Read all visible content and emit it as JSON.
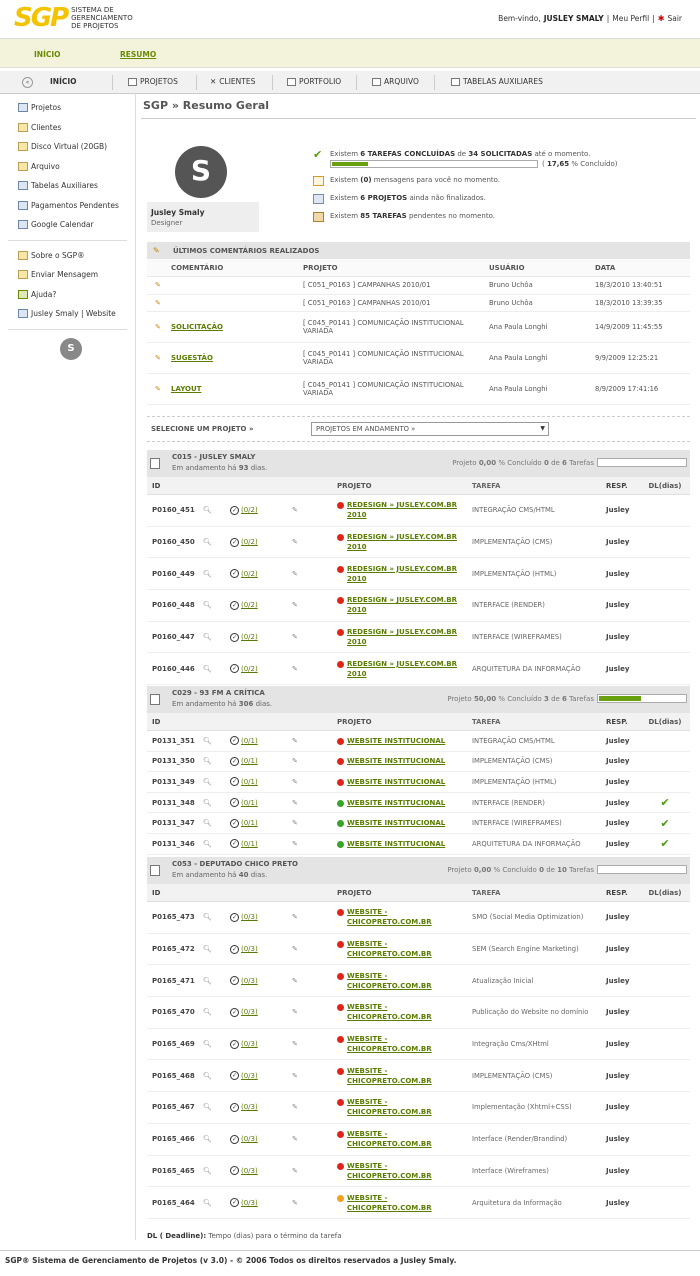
{
  "app": {
    "logo": "SGP",
    "logo_text": "SISTEMA DE GERENCIAMENTO DE PROJETOS",
    "welcome": "Bem-vindo,",
    "user": "JUSLEY SMALY",
    "profile": "Meu Perfil",
    "logout": "Sair"
  },
  "subnav": {
    "inicio": "INÍCIO",
    "resumo": "RESUMO"
  },
  "nav": {
    "back": "«",
    "inicio": "INÍCIO",
    "projetos": "PROJETOS",
    "clientes": "CLIENTES",
    "portfolio": "PORTFOLIO",
    "arquivo": "ARQUIVO",
    "tabelas": "TABELAS AUXILIARES"
  },
  "sidebar": {
    "items": [
      "Projetos",
      "Clientes",
      "Disco Virtual (20GB)",
      "Arquivo",
      "Tabelas Auxiliares",
      "Pagamentos Pendentes",
      "Google Calendar"
    ],
    "items2": [
      "Sobre o SGP®",
      "Enviar Mensagem",
      "Ajuda?",
      "Jusley Smaly | Website"
    ]
  },
  "page": {
    "title": "SGP » Resumo Geral"
  },
  "profile": {
    "name": "Jusley Smaly",
    "role": "Designer",
    "avatar": "S"
  },
  "stats": {
    "s1_pre": "Existem",
    "s1_a": "6 TAREFAS CONCLUÍDAS",
    "s1_mid": "de",
    "s1_b": "34 SOLICITADAS",
    "s1_post": "até o momento.",
    "progress_pre": "(",
    "progress_value": "17,65",
    "progress_post": "% Concluído)",
    "progress_fraction": 0.1765,
    "s2_pre": "Existem",
    "s2_b": "(0)",
    "s2_post": "mensagens para você no momento.",
    "s3_pre": "Existem",
    "s3_b": "6 PROJETOS",
    "s3_post": "ainda não finalizados.",
    "s4_pre": "Existem",
    "s4_b": "85 TAREFAS",
    "s4_post": "pendentes no momento."
  },
  "comments": {
    "heading": "ÚLTIMOS COMENTÁRIOS REALIZADOS",
    "headers": [
      "COMENTÁRIO",
      "PROJETO",
      "USUÁRIO",
      "DATA"
    ],
    "rows": [
      {
        "comment": "",
        "code": "[ C051_P0163 ]",
        "project": "CAMPANHAS 2010/01",
        "user": "Bruno Uchôa",
        "date": "18/3/2010 13:40:51"
      },
      {
        "comment": "",
        "code": "[ C051_P0163 ]",
        "project": "CAMPANHAS 2010/01",
        "user": "Bruno Uchôa",
        "date": "18/3/2010 13:39:35"
      },
      {
        "comment": "SOLICITAÇÃO",
        "code": "[ C045_P0141 ]",
        "project": "COMUNICAÇÃO INSTITUCIONAL VARIADA",
        "user": "Ana Paula Longhi",
        "date": "14/9/2009 11:45:55"
      },
      {
        "comment": "SUGESTÃO",
        "code": "[ C045_P0141 ]",
        "project": "COMUNICAÇÃO INSTITUCIONAL VARIADA",
        "user": "Ana Paula Longhi",
        "date": "9/9/2009 12:25:21"
      },
      {
        "comment": "LAYOUT",
        "code": "[ C045_P0141 ]",
        "project": "COMUNICAÇÃO INSTITUCIONAL VARIADA",
        "user": "Ana Paula Longhi",
        "date": "8/9/2009 17:41:16"
      }
    ]
  },
  "select": {
    "label": "SELECIONE UM PROJETO »",
    "value": "PROJETOS EM ANDAMENTO »",
    "arrow": "▼"
  },
  "table_headers": [
    "ID",
    "PROJETO",
    "TAREFA",
    "RESP.",
    "DL(dias)"
  ],
  "projects": [
    {
      "name": "C015 - JUSLEY SMALY",
      "sub_pre": "Em andamento há",
      "days": "93",
      "sub_post": "dias.",
      "prog_pre": "Projeto",
      "pct": "0,00",
      "prog_mid": "% Concluído",
      "done": "0",
      "of": "de",
      "total": "6",
      "tasks_word": "Tarefas",
      "fraction": 0,
      "rows": [
        {
          "id": "P0160_451",
          "sub": "(0/2)",
          "proj": "REDESIGN » JUSLEY.COM.BR 2010",
          "dot": "red",
          "task": "INTEGRAÇÃO CMS/HTML",
          "resp": "Jusley",
          "dl": ""
        },
        {
          "id": "P0160_450",
          "sub": "(0/2)",
          "proj": "REDESIGN » JUSLEY.COM.BR 2010",
          "dot": "red",
          "task": "IMPLEMENTAÇÃO (CMS)",
          "resp": "Jusley",
          "dl": ""
        },
        {
          "id": "P0160_449",
          "sub": "(0/2)",
          "proj": "REDESIGN » JUSLEY.COM.BR 2010",
          "dot": "red",
          "task": "IMPLEMENTAÇÃO (HTML)",
          "resp": "Jusley",
          "dl": ""
        },
        {
          "id": "P0160_448",
          "sub": "(0/2)",
          "proj": "REDESIGN » JUSLEY.COM.BR 2010",
          "dot": "red",
          "task": "INTERFACE (RENDER)",
          "resp": "Jusley",
          "dl": ""
        },
        {
          "id": "P0160_447",
          "sub": "(0/2)",
          "proj": "REDESIGN » JUSLEY.COM.BR 2010",
          "dot": "red",
          "task": "INTERFACE (WIREFRAMES)",
          "resp": "Jusley",
          "dl": ""
        },
        {
          "id": "P0160_446",
          "sub": "(0/2)",
          "proj": "REDESIGN » JUSLEY.COM.BR 2010",
          "dot": "red",
          "task": "ARQUITETURA DA INFORMAÇÃO",
          "resp": "Jusley",
          "dl": ""
        }
      ]
    },
    {
      "name": "C029 - 93 FM A CRÍTICA",
      "sub_pre": "Em andamento há",
      "days": "306",
      "sub_post": "dias.",
      "prog_pre": "Projeto",
      "pct": "50,00",
      "prog_mid": "% Concluído",
      "done": "3",
      "of": "de",
      "total": "6",
      "tasks_word": "Tarefas",
      "fraction": 0.5,
      "rows": [
        {
          "id": "P0131_351",
          "sub": "(0/1)",
          "proj": "WEBSITE INSTITUCIONAL",
          "dot": "red",
          "task": "INTEGRAÇÃO CMS/HTML",
          "resp": "Jusley",
          "dl": ""
        },
        {
          "id": "P0131_350",
          "sub": "(0/1)",
          "proj": "WEBSITE INSTITUCIONAL",
          "dot": "red",
          "task": "IMPLEMENTAÇÃO (CMS)",
          "resp": "Jusley",
          "dl": ""
        },
        {
          "id": "P0131_349",
          "sub": "(0/1)",
          "proj": "WEBSITE INSTITUCIONAL",
          "dot": "red",
          "task": "IMPLEMENTAÇÃO (HTML)",
          "resp": "Jusley",
          "dl": ""
        },
        {
          "id": "P0131_348",
          "sub": "(0/1)",
          "proj": "WEBSITE INSTITUCIONAL",
          "dot": "green",
          "task": "INTERFACE (RENDER)",
          "resp": "Jusley",
          "dl": "✔"
        },
        {
          "id": "P0131_347",
          "sub": "(0/1)",
          "proj": "WEBSITE INSTITUCIONAL",
          "dot": "green",
          "task": "INTERFACE (WIREFRAMES)",
          "resp": "Jusley",
          "dl": "✔"
        },
        {
          "id": "P0131_346",
          "sub": "(0/1)",
          "proj": "WEBSITE INSTITUCIONAL",
          "dot": "green",
          "task": "ARQUITETURA DA INFORMAÇÃO",
          "resp": "Jusley",
          "dl": "✔"
        }
      ]
    },
    {
      "name": "C053 - DEPUTADO CHICO PRETO",
      "sub_pre": "Em andamento há",
      "days": "40",
      "sub_post": "dias.",
      "prog_pre": "Projeto",
      "pct": "0,00",
      "prog_mid": "% Concluído",
      "done": "0",
      "of": "de",
      "total": "10",
      "tasks_word": "Tarefas",
      "fraction": 0,
      "rows": [
        {
          "id": "P0165_473",
          "sub": "(0/3)",
          "proj": "WEBSITE - CHICOPRETO.COM.BR",
          "dot": "red",
          "task": "SMO (Social Media Optimization)",
          "resp": "Jusley",
          "dl": ""
        },
        {
          "id": "P0165_472",
          "sub": "(0/3)",
          "proj": "WEBSITE - CHICOPRETO.COM.BR",
          "dot": "red",
          "task": "SEM (Search Engine Marketing)",
          "resp": "Jusley",
          "dl": ""
        },
        {
          "id": "P0165_471",
          "sub": "(0/3)",
          "proj": "WEBSITE - CHICOPRETO.COM.BR",
          "dot": "red",
          "task": "Atualização Inicial",
          "resp": "Jusley",
          "dl": ""
        },
        {
          "id": "P0165_470",
          "sub": "(0/3)",
          "proj": "WEBSITE - CHICOPRETO.COM.BR",
          "dot": "red",
          "task": "Publicação do Website no domínio",
          "resp": "Jusley",
          "dl": ""
        },
        {
          "id": "P0165_469",
          "sub": "(0/3)",
          "proj": "WEBSITE - CHICOPRETO.COM.BR",
          "dot": "red",
          "task": "Integração Cms/XHtml",
          "resp": "Jusley",
          "dl": ""
        },
        {
          "id": "P0165_468",
          "sub": "(0/3)",
          "proj": "WEBSITE - CHICOPRETO.COM.BR",
          "dot": "red",
          "task": "IMPLEMENTAÇÃO (CMS)",
          "resp": "Jusley",
          "dl": ""
        },
        {
          "id": "P0165_467",
          "sub": "(0/3)",
          "proj": "WEBSITE - CHICOPRETO.COM.BR",
          "dot": "red",
          "task": "Implementação (Xhtml+CSS)",
          "resp": "Jusley",
          "dl": ""
        },
        {
          "id": "P0165_466",
          "sub": "(0/3)",
          "proj": "WEBSITE - CHICOPRETO.COM.BR",
          "dot": "red",
          "task": "Interface (Render/Brandind)",
          "resp": "Jusley",
          "dl": ""
        },
        {
          "id": "P0165_465",
          "sub": "(0/3)",
          "proj": "WEBSITE - CHICOPRETO.COM.BR",
          "dot": "red",
          "task": "Interface (Wireframes)",
          "resp": "Jusley",
          "dl": ""
        },
        {
          "id": "P0165_464",
          "sub": "(0/3)",
          "proj": "WEBSITE - CHICOPRETO.COM.BR",
          "dot": "orange",
          "task": "Arquitetura da Informação",
          "resp": "Jusley",
          "dl": ""
        }
      ]
    }
  ],
  "legend": {
    "key": "DL ( Deadline):",
    "text": "Tempo (dias) para o término da tarefa"
  },
  "footer": {
    "text": "SGP® Sistema de Gerenciamento de Projetos (v 3.0) - © 2006 Todos os direitos reservados a Jusley Smaly."
  },
  "colors": {
    "brand_yellow": "#f3c300",
    "link_green": "#5a7d00",
    "progress_green": "#68a010",
    "status_red": "#e02418",
    "status_green": "#3aa32a",
    "status_orange": "#f0a020"
  }
}
